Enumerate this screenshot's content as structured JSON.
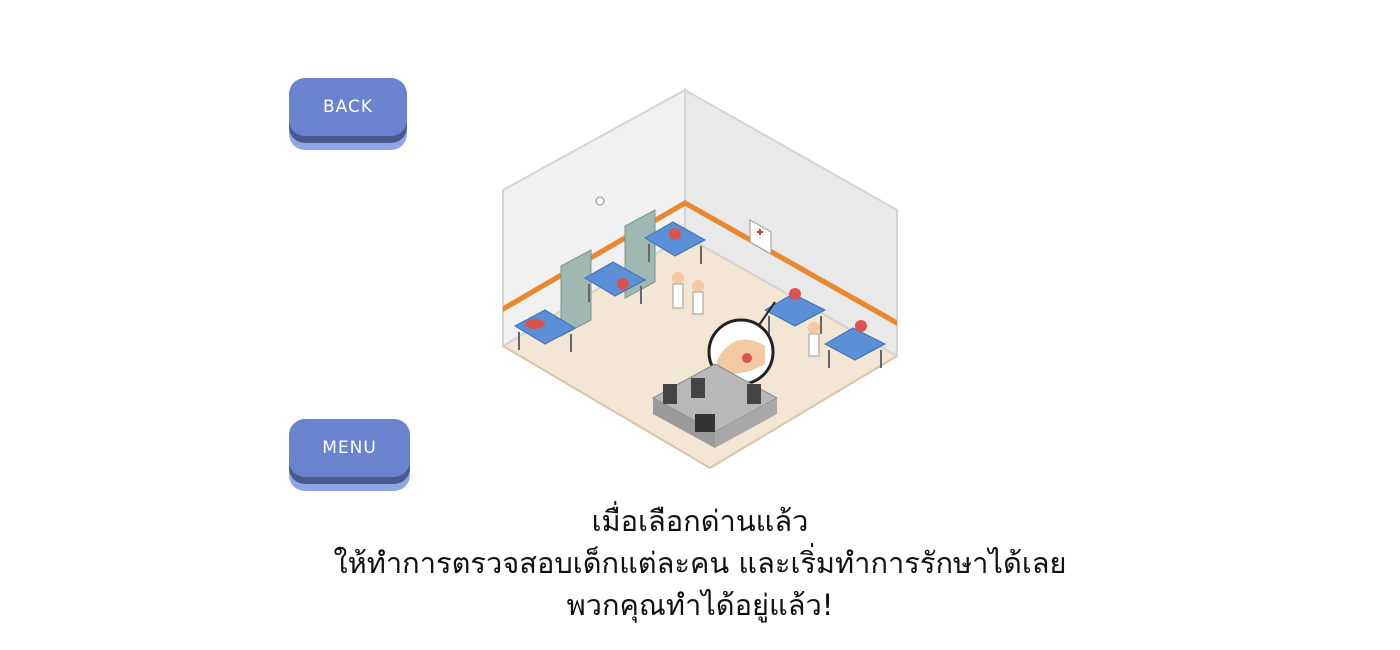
{
  "buttons": {
    "back_label": "BACK",
    "menu_label": "MENU"
  },
  "caption": {
    "line1": "เมื่อเลือกด่านแล้ว",
    "line2": "ให้ทำการตรวจสอบเด็กแต่ละคน และเริ่มทำการรักษาได้เลย",
    "line3": "พวกคุณทำได้อยู่แล้ว!"
  },
  "colors": {
    "button_face": "#6b82cf",
    "button_shadow": "#4b5a8c",
    "button_base": "#8fa6e6",
    "wall_stripe": "#e8892f",
    "bed_mattress": "#5b8fd6",
    "floor": "#f4e6d4"
  }
}
